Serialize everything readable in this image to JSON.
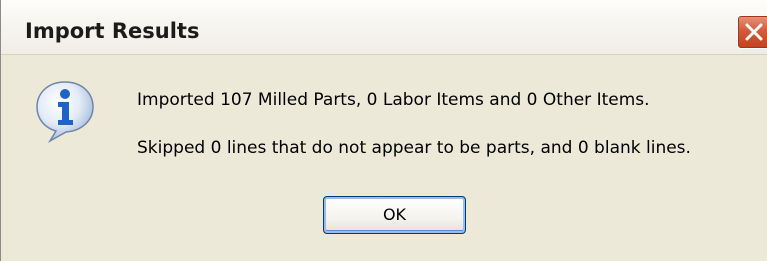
{
  "window": {
    "title": "Import Results"
  },
  "icons": {
    "message_icon": "info-icon",
    "close_icon": "close-icon"
  },
  "message": {
    "line1": "Imported 107 Milled Parts, 0 Labor Items and 0 Other Items.",
    "line2": "Skipped 0 lines that do not appear to be parts, and 0 blank lines."
  },
  "buttons": {
    "ok_label": "OK"
  },
  "colors": {
    "dialog_background": "#ece9d8",
    "close_button": "#c7472a",
    "info_icon_blue": "#1f63c6"
  }
}
